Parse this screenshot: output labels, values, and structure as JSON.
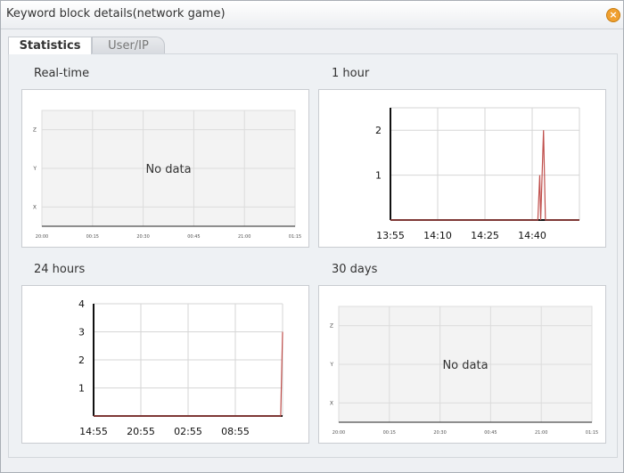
{
  "dialog": {
    "title": "Keyword block details(network game)",
    "close_icon": "close-icon"
  },
  "tabs": [
    {
      "label": "Statistics",
      "active": true
    },
    {
      "label": "User/IP",
      "active": false
    }
  ],
  "charts": {
    "realtime": {
      "label": "Real-time",
      "empty_text": "No data"
    },
    "hour": {
      "label": "1 hour"
    },
    "day": {
      "label": "24 hours"
    },
    "month": {
      "label": "30 days",
      "empty_text": "No data"
    }
  },
  "colors": {
    "line": "#c0504d",
    "axis": "#111111",
    "grid": "#d6d6d6",
    "close": "#f0a030"
  },
  "chart_data": [
    {
      "type": "line",
      "title": "Real-time",
      "empty": true,
      "no_data_text": "No data",
      "y_tick_labels": [
        "Z",
        "Y",
        "X"
      ],
      "x_tick_labels": [
        "20:00",
        "00:15",
        "20:30",
        "00:45",
        "21:00",
        "01:15"
      ]
    },
    {
      "type": "line",
      "title": "1 hour",
      "x_tick_labels": [
        "13:55",
        "14:10",
        "14:25",
        "14:40"
      ],
      "y_ticks": [
        1,
        2
      ],
      "ylim": [
        0,
        2.5
      ],
      "series": [
        {
          "points": [
            [
              0,
              0
            ],
            [
              0.78,
              0
            ],
            [
              0.79,
              1
            ],
            [
              0.795,
              0
            ],
            [
              0.81,
              2
            ],
            [
              0.82,
              0
            ],
            [
              1,
              0
            ]
          ]
        }
      ]
    },
    {
      "type": "line",
      "title": "24 hours",
      "x_tick_labels": [
        "14:55",
        "20:55",
        "02:55",
        "08:55"
      ],
      "y_ticks": [
        1,
        2,
        3,
        4
      ],
      "ylim": [
        0,
        4
      ],
      "series": [
        {
          "points": [
            [
              0,
              0
            ],
            [
              0.99,
              0
            ],
            [
              1,
              3
            ]
          ]
        }
      ]
    },
    {
      "type": "line",
      "title": "30 days",
      "empty": true,
      "no_data_text": "No data",
      "y_tick_labels": [
        "Z",
        "Y",
        "X"
      ],
      "x_tick_labels": [
        "20:00",
        "00:15",
        "20:30",
        "00:45",
        "21:00",
        "01:15"
      ]
    }
  ]
}
